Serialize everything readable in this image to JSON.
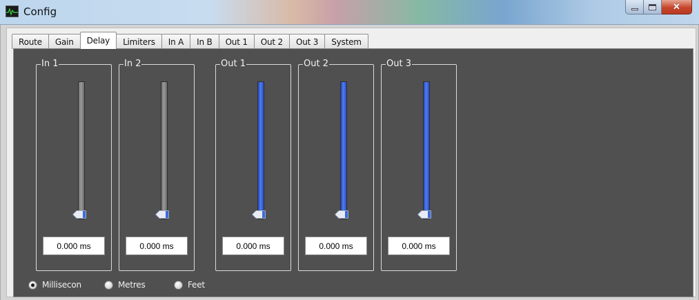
{
  "window": {
    "title": "Config"
  },
  "tabs": [
    {
      "label": "Route"
    },
    {
      "label": "Gain"
    },
    {
      "label": "Delay"
    },
    {
      "label": "Limiters"
    },
    {
      "label": "In A"
    },
    {
      "label": "In B"
    },
    {
      "label": "Out 1"
    },
    {
      "label": "Out 2"
    },
    {
      "label": "Out 3"
    },
    {
      "label": "System"
    }
  ],
  "active_tab": "Delay",
  "channels": [
    {
      "label": "In 1",
      "value": "0.000 ms",
      "slider_color": "grey",
      "level": 0
    },
    {
      "label": "In 2",
      "value": "0.000 ms",
      "slider_color": "grey",
      "level": 0
    },
    {
      "label": "Out 1",
      "value": "0.000 ms",
      "slider_color": "blue",
      "level": 0
    },
    {
      "label": "Out 2",
      "value": "0.000 ms",
      "slider_color": "blue",
      "level": 0
    },
    {
      "label": "Out 3",
      "value": "0.000 ms",
      "slider_color": "blue",
      "level": 0
    }
  ],
  "units": {
    "options": [
      {
        "label": "Millisecon",
        "selected": true
      },
      {
        "label": "Metres",
        "selected": false
      },
      {
        "label": "Feet",
        "selected": false
      }
    ]
  },
  "colors": {
    "panel_bg": "#505050",
    "slider_blue": "#3d6be0",
    "slider_grey": "#8a8a8a"
  }
}
